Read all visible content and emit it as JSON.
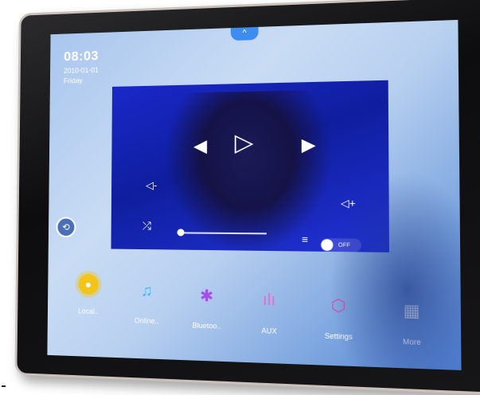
{
  "status": {
    "time": "08:03",
    "date": "2010-01-01",
    "day": "Friday"
  },
  "pull_tab": {
    "glyph": "^"
  },
  "player": {
    "prev_icon": "◀",
    "play_icon": "▷",
    "next_icon": "▶",
    "volume_down_icon": "◁-",
    "volume_up_icon": "◁+",
    "shuffle_icon": "⤮",
    "eq_icon": "≡",
    "progress": 0.02,
    "toggle_label": "OFF"
  },
  "side_button_icon": "⟲",
  "dock": [
    {
      "label": "Local..",
      "icon": "usb-disk-icon",
      "glyph": "●"
    },
    {
      "label": "Online..",
      "icon": "music-note-icon",
      "glyph": "♫"
    },
    {
      "label": "Bluetoo..",
      "icon": "bluetooth-icon",
      "glyph": "✱"
    },
    {
      "label": "AUX",
      "icon": "aux-bars-icon",
      "glyph": "ılı"
    },
    {
      "label": "Settings",
      "icon": "settings-hexagon-icon",
      "glyph": "⬡"
    },
    {
      "label": "More",
      "icon": "more-grid-icon",
      "glyph": "▦"
    }
  ],
  "colors": {
    "accent": "#3d8df0",
    "player_bg": "#1a28c9"
  }
}
